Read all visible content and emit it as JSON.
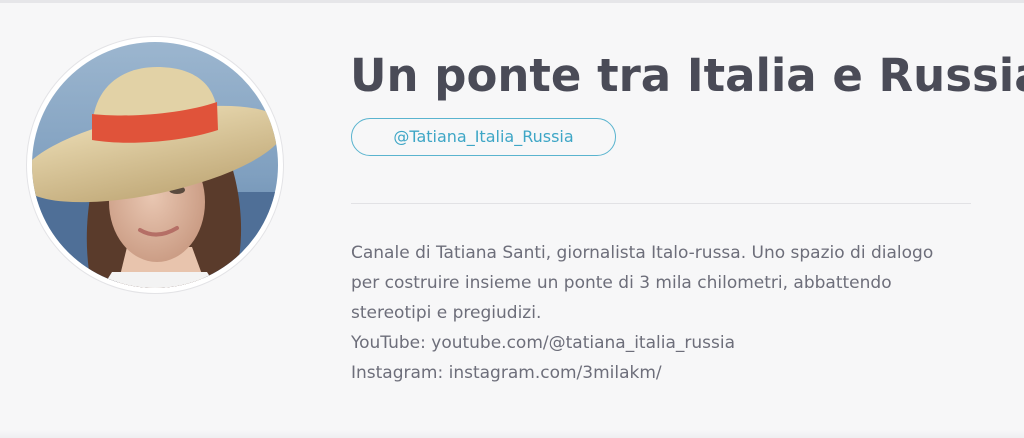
{
  "profile": {
    "title": "Un ponte tra Italia e Russia",
    "handle": "@Tatiana_Italia_Russia",
    "avatar_alt": "channel-avatar-photo",
    "description_lines": [
      "Canale di Tatiana Santi, giornalista Italo-russa. Uno spazio di dialogo",
      "per costruire insieme un ponte di 3 mila chilometri, abbattendo",
      "stereotipi e pregiudizi.",
      "YouTube: youtube.com/@tatiana_italia_russia",
      "Instagram: instagram.com/3milakm/"
    ]
  },
  "colors": {
    "background": "#f7f7f8",
    "title": "#4a4b57",
    "accent": "#3ea6c6",
    "text": "#6d6e7a"
  }
}
